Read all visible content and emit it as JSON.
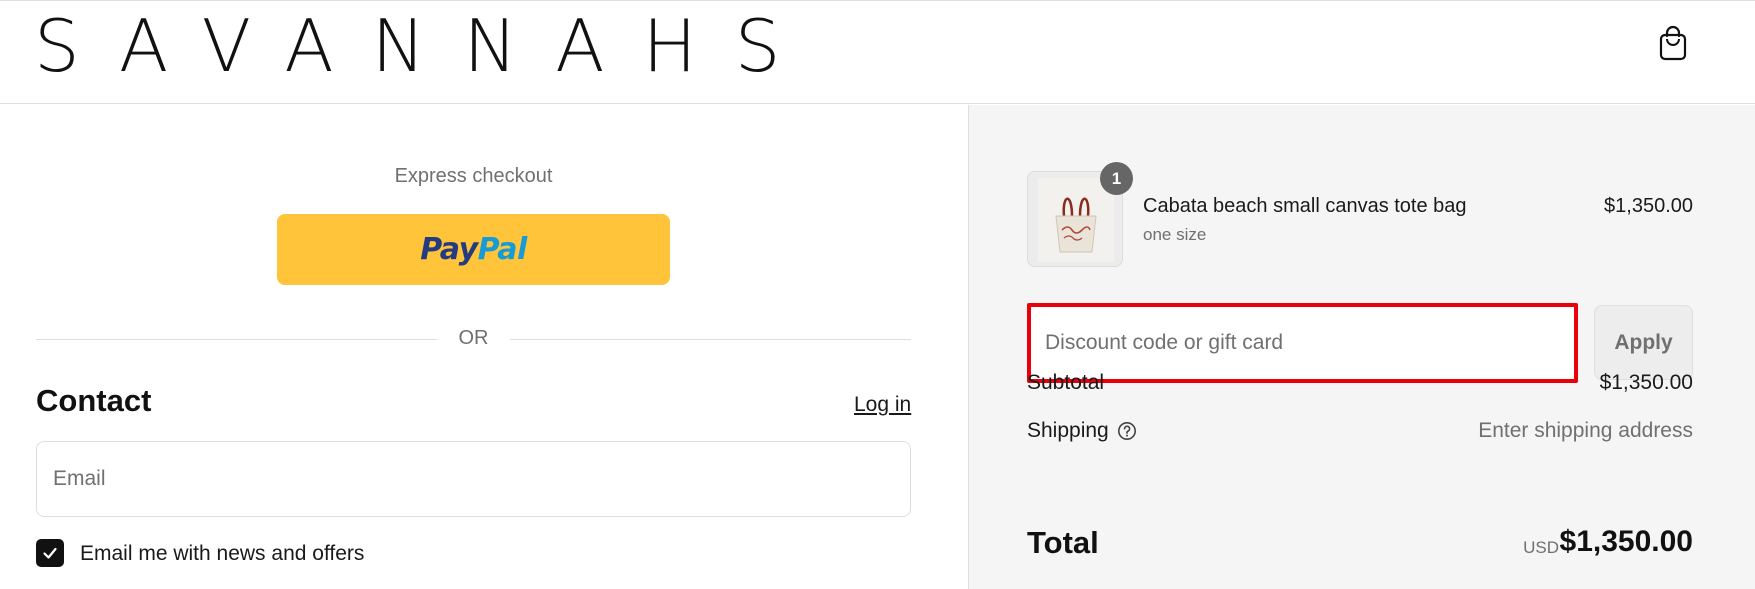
{
  "header": {
    "logo_text": "SAVANNAHS",
    "cart_icon": "shopping-bag-icon"
  },
  "express": {
    "label": "Express checkout",
    "paypal_pay": "Pay",
    "paypal_pal": "Pal",
    "or_text": "OR"
  },
  "contact": {
    "title": "Contact",
    "login_label": "Log in",
    "email_placeholder": "Email",
    "newsletter_label": "Email me with news and offers",
    "newsletter_checked": true
  },
  "summary": {
    "product": {
      "name": "Cabata beach small canvas tote bag",
      "variant": "one size",
      "price": "$1,350.00",
      "quantity": "1"
    },
    "discount_placeholder": "Discount code or gift card",
    "apply_label": "Apply",
    "subtotal_label": "Subtotal",
    "subtotal_value": "$1,350.00",
    "shipping_label": "Shipping",
    "shipping_value": "Enter shipping address",
    "total_label": "Total",
    "total_currency": "USD",
    "total_value": "$1,350.00"
  },
  "colors": {
    "paypal_yellow": "#ffc439",
    "paypal_dark_blue": "#253b80",
    "paypal_light_blue": "#179bd7",
    "highlight_red": "#e8000b",
    "summary_bg": "#f5f5f5"
  }
}
